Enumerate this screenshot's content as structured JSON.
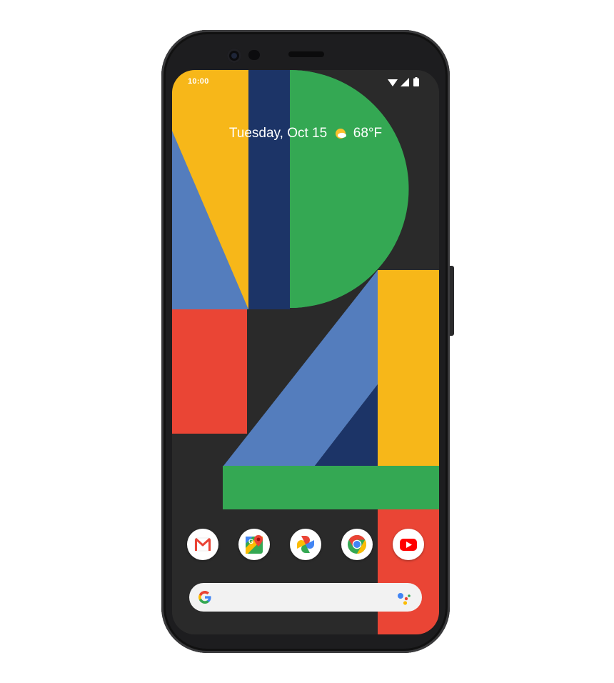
{
  "status_bar": {
    "time": "10:00",
    "icons": [
      "wifi-icon",
      "cellular-signal-icon",
      "battery-icon"
    ]
  },
  "at_a_glance": {
    "date": "Tuesday, Oct 15",
    "weather_icon": "partly-sunny-icon",
    "temperature": "68°F"
  },
  "dock": {
    "apps": [
      {
        "name": "Gmail",
        "icon": "gmail-icon"
      },
      {
        "name": "Maps",
        "icon": "maps-icon"
      },
      {
        "name": "Photos",
        "icon": "photos-icon"
      },
      {
        "name": "Chrome",
        "icon": "chrome-icon"
      },
      {
        "name": "YouTube",
        "icon": "youtube-icon"
      }
    ]
  },
  "search_bar": {
    "logo_icon": "google-g-icon",
    "assistant_icon": "google-assistant-icon"
  },
  "colors": {
    "blue": "#547dbd",
    "yellow": "#f7b719",
    "navy": "#1c3467",
    "green": "#34a853",
    "red": "#ea4535",
    "background": "#2a2a2a"
  }
}
